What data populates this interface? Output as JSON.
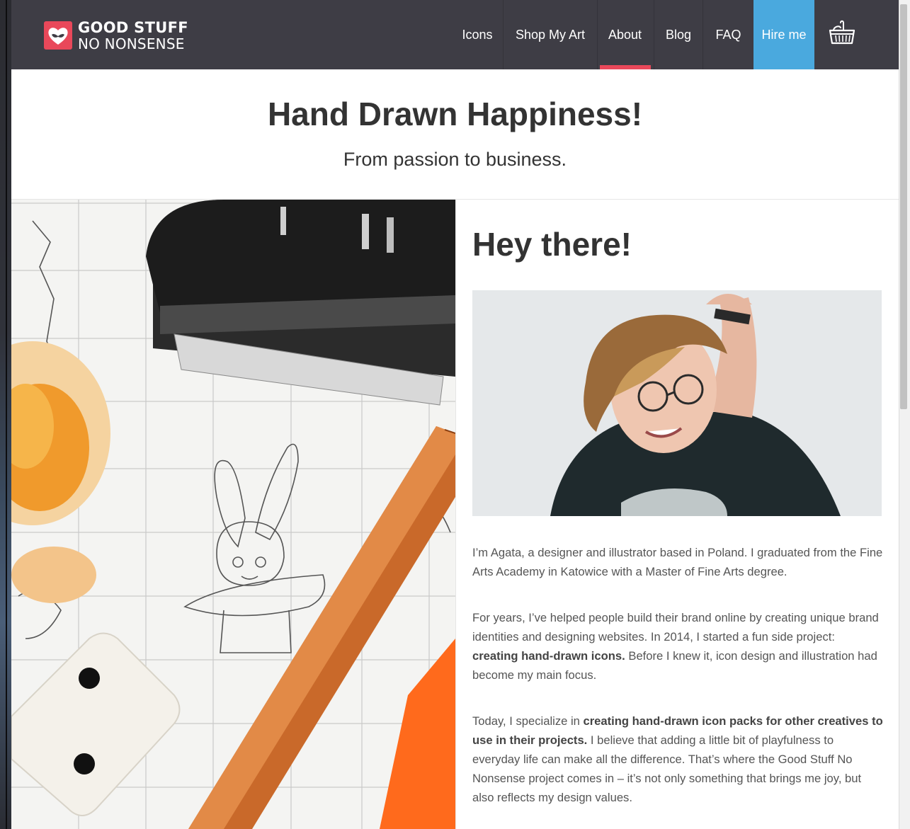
{
  "logo": {
    "line1": "GOOD STUFF",
    "line2": "NO NONSENSE"
  },
  "nav": {
    "items": [
      {
        "label": "Icons"
      },
      {
        "label": "Shop My Art"
      },
      {
        "label": "About",
        "active": true
      },
      {
        "label": "Blog"
      },
      {
        "label": "FAQ"
      },
      {
        "label": "Hire me"
      }
    ],
    "cart_icon": "basket-icon"
  },
  "hero": {
    "title": "Hand Drawn Happiness!",
    "subtitle": "From passion to business."
  },
  "about": {
    "heading": "Hey there!",
    "p1": "I’m Agata, a designer and illustrator based in Poland. I graduated from the Fine Arts Academy in Katowice with a Master of Fine Arts degree.",
    "p2_a": "For years, I’ve helped people build their brand online by creating unique brand identities and designing websites. In 2014, I started a fun side project: ",
    "p2_bold": "creating hand-drawn icons.",
    "p2_b": " Before I knew it, icon design and illustration had become my main focus.",
    "p3_a": "Today, I specialize in ",
    "p3_bold": "creating hand-drawn icon packs for other creatives to use in their projects.",
    "p3_b": " I believe that adding a little bit of playfulness to everyday life can make all the difference. That’s where the Good Stuff No Nonsense project comes in – it’s not only something that brings me joy, but also reflects my design values."
  },
  "colors": {
    "header_bg": "#3e3d45",
    "accent_red": "#e9485a",
    "hire_blue": "#4aa9de",
    "heading_text": "#333333",
    "body_text": "#555555"
  }
}
